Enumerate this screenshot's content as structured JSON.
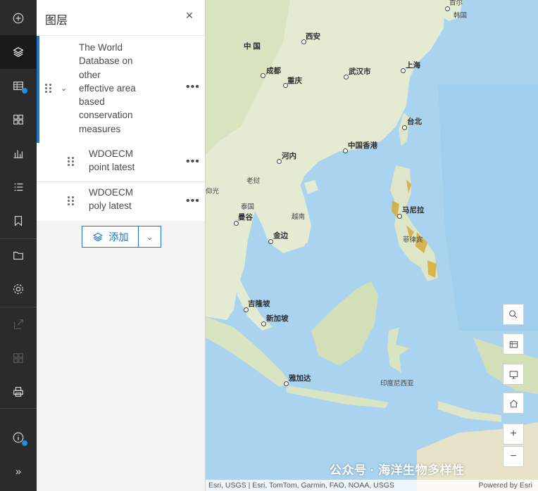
{
  "toolbar": {
    "items": [
      {
        "name": "add-icon"
      },
      {
        "name": "layers-icon"
      },
      {
        "name": "table-icon"
      },
      {
        "name": "widgets-icon"
      },
      {
        "name": "chart-icon"
      },
      {
        "name": "legend-icon"
      },
      {
        "name": "bookmark-icon"
      },
      {
        "name": "folder-icon"
      },
      {
        "name": "settings-icon"
      },
      {
        "name": "share-icon"
      },
      {
        "name": "grid-icon"
      },
      {
        "name": "print-icon"
      },
      {
        "name": "info-icon"
      },
      {
        "name": "expand-icon"
      }
    ],
    "expand_label": "»"
  },
  "panel": {
    "title": "图层",
    "close_label": "×",
    "layer_group": {
      "lines": [
        "The World",
        "Database on",
        "other",
        "effective area",
        "based",
        "conservation",
        "measures"
      ]
    },
    "sublayers": [
      {
        "line1": "WDOECM",
        "line2": "point latest"
      },
      {
        "line1": "WDOECM",
        "line2": "poly latest"
      }
    ],
    "more_label": "•••",
    "add_label": "添加"
  },
  "map": {
    "cities": [
      {
        "label": "中 国"
      },
      {
        "label": "西安"
      },
      {
        "label": "成都"
      },
      {
        "label": "重庆"
      },
      {
        "label": "武汉市"
      },
      {
        "label": "上海"
      },
      {
        "label": "台北"
      },
      {
        "label": "中国香港"
      },
      {
        "label": "河内"
      },
      {
        "label": "老挝"
      },
      {
        "label": "泰国"
      },
      {
        "label": "曼谷"
      },
      {
        "label": "越南"
      },
      {
        "label": "金边"
      },
      {
        "label": "马尼拉"
      },
      {
        "label": "菲律宾"
      },
      {
        "label": "吉隆坡"
      },
      {
        "label": "新加坡"
      },
      {
        "label": "雅加达"
      },
      {
        "label": "印度尼西亚"
      },
      {
        "label": "首尔"
      },
      {
        "label": "韩国"
      },
      {
        "label": "仰光"
      }
    ],
    "attribution": "Esri, USGS | Esri, TomTom, Garmin, FAO, NOAA, USGS",
    "powered_by": "Powered by Esri",
    "zoom_in": "+",
    "zoom_out": "−",
    "watermark": "公众号 · 海洋生物多样性",
    "colors": {
      "sea": "#a9d3ef",
      "land": "#e8eddc",
      "ocm": "#d8a93a"
    }
  }
}
